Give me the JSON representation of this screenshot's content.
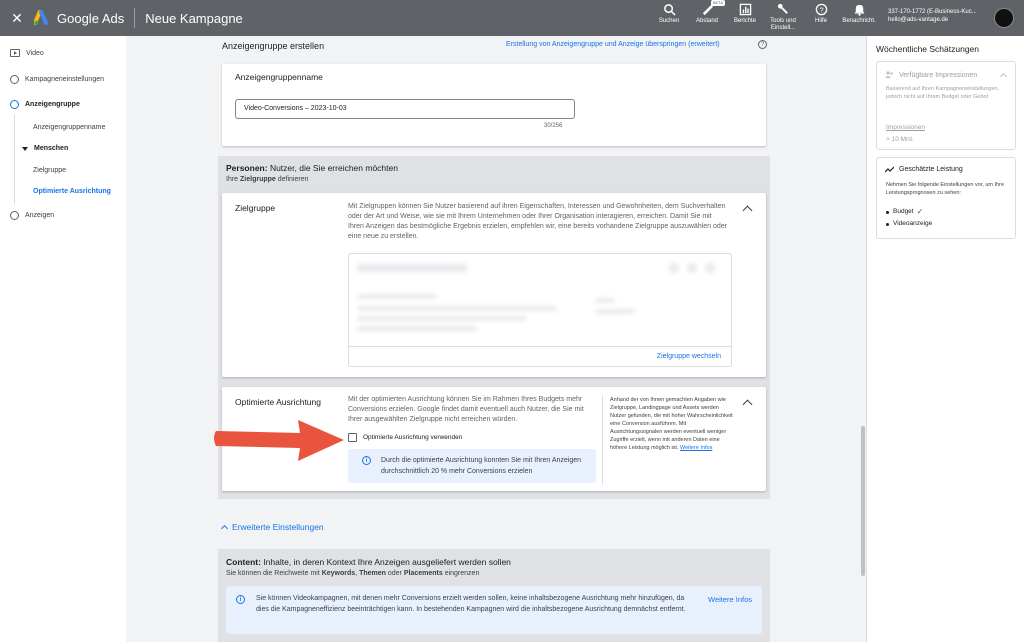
{
  "topbar": {
    "close_label": "✕",
    "brand": "Google Ads",
    "title": "Neue Kampagne",
    "actions": [
      {
        "icon": "search-icon",
        "label": "Suchen"
      },
      {
        "icon": "measure-icon",
        "label": "Abstand",
        "badge": "BETA"
      },
      {
        "icon": "reports-icon",
        "label": "Berichte"
      },
      {
        "icon": "tools-icon",
        "label": "Tools und Einstell..."
      },
      {
        "icon": "help-icon",
        "label": "Hilfe"
      },
      {
        "icon": "bell-icon",
        "label": "Benachricht."
      }
    ],
    "account_id": "337-170-1772 (E-Business-Kuc...",
    "account_email": "hello@ads-vantage.de"
  },
  "leftnav": {
    "video": "Video",
    "campaign_settings": "Kampagneneinstellungen",
    "ad_group": "Anzeigengruppe",
    "ad_group_name": "Anzeigengruppenname",
    "people": "Menschen",
    "audience": "Zielgruppe",
    "optimized_targeting": "Optimierte Ausrichtung",
    "ads": "Anzeigen"
  },
  "main": {
    "section_title": "Anzeigengruppe erstellen",
    "skip_link": "Erstellung von Anzeigengruppe und Anzeige überspringen (erweitert)",
    "help_glyph": "?",
    "name_card": {
      "title": "Anzeigengruppenname",
      "value": "Video-Conversions – 2023-10-03",
      "counter": "30/256"
    },
    "people": {
      "title_bold": "Personen:",
      "title_rest": " Nutzer, die Sie erreichen möchten",
      "sub_pre": "Ihre ",
      "sub_bold": "Zielgruppe",
      "sub_post": " definieren"
    },
    "audience_card": {
      "title": "Zielgruppe",
      "description": "Mit Zielgruppen können Sie Nutzer basierend auf ihren Eigenschaften, Interessen und Gewohnheiten, dem Suchverhalten oder der Art und Weise, wie sie mit Ihrem Unternehmen oder Ihrer Organisation interagieren, erreichen. Damit Sie mit Ihren Anzeigen das bestmögliche Ergebnis erzielen, empfehlen wir, eine bereits vorhandene Zielgruppe auszuwählen oder eine neue zu erstellen.",
      "change_link": "Zielgruppe wechseln"
    },
    "optimized_card": {
      "title": "Optimierte Ausrichtung",
      "description": "Mit der optimierten Ausrichtung können Sie im Rahmen Ihres Budgets mehr Conversions erzielen. Google findet damit eventuell auch Nutzer, die Sie mit Ihrer ausgewählten Zielgruppe nicht erreichen würden.",
      "checkbox_label": "Optimierte Ausrichtung verwenden",
      "checkbox_checked": false,
      "info_glyph": "i",
      "info_text": "Durch die optimierte Ausrichtung konnten Sie mit Ihren Anzeigen durchschnittlich 20 % mehr Conversions erzielen",
      "side_note": "Anhand der von Ihnen gemachten Angaben wie Zielgruppe, Landingpage und Assets werden Nutzer gefunden, die mit hoher Wahrscheinlichkeit eine Conversion ausführen. Mit Ausrichtungssignalen werden eventuell weniger Zugriffe erzielt, wenn mit anderen Daten eine höhere Leistung möglich ist.",
      "side_link": "Weitere Infos"
    },
    "advanced_settings": "Erweiterte Einstellungen",
    "content": {
      "title_bold": "Content:",
      "title_rest": " Inhalte, in deren Kontext Ihre Anzeigen ausgeliefert werden sollen",
      "sub_pre": "Sie können die Reichweite mit ",
      "sub_k1": "Keywords",
      "sub_sep1": ", ",
      "sub_k2": "Themen",
      "sub_sep2": " oder ",
      "sub_k3": "Placements",
      "sub_post": " eingrenzen",
      "info_text": "Sie können Videokampagnen, mit denen mehr Conversions erzielt werden sollen, keine inhaltsbezogene Ausrichtung mehr hinzufügen, da dies die Kampagneneffizienz beeinträchtigen kann. In bestehenden Kampagnen wird die inhaltsbezogene Ausrichtung demnächst entfernt.",
      "info_link": "Weitere Infos"
    }
  },
  "rightpanel": {
    "title": "Wöchentliche Schätzungen",
    "impressions_card": {
      "title": "Verfügbare Impressionen",
      "text": "Basierend auf Ihren Kampagneneinstellungen, jedoch nicht auf Ihrem Budget oder Gebot",
      "label": "Impressionen",
      "value": "> 10 Mrd."
    },
    "performance_card": {
      "title": "Geschätzte Leistung",
      "text": "Nehmen Sie folgende Einstellungen vor, um Ihre Leistungsprognosen zu sehen:",
      "items": [
        "Budget",
        "Videoanzeige"
      ],
      "check_glyph": "✓"
    }
  },
  "colors": {
    "accent": "#1a73e8",
    "topbar": "#5f6368",
    "arrow": "#e8543e"
  }
}
